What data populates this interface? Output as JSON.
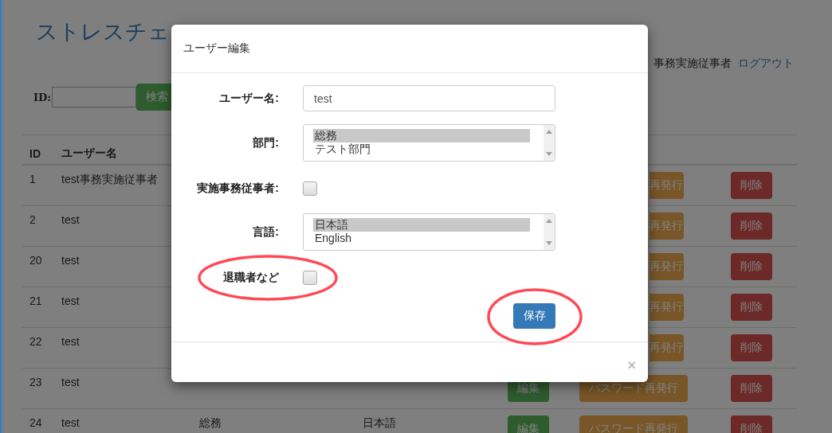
{
  "page": {
    "title": "ストレスチェ",
    "user": "事務実施従事者",
    "logout": "ログアウト",
    "search": {
      "label": "ID:",
      "button": "検索"
    },
    "table": {
      "columns": [
        "ID",
        "ユーザー名"
      ],
      "rows": [
        {
          "id": "1",
          "name": "test事務実施従事者",
          "reissue": "再発行",
          "delete": "削除"
        },
        {
          "id": "2",
          "name": "test",
          "reissue": "再発行",
          "delete": "削除"
        },
        {
          "id": "20",
          "name": "test",
          "reissue": "再発行",
          "delete": "削除"
        },
        {
          "id": "21",
          "name": "test",
          "reissue": "再発行",
          "delete": "削除"
        },
        {
          "id": "22",
          "name": "test",
          "reissue": "再発行",
          "delete": "削除"
        },
        {
          "id": "23",
          "name": "test",
          "edit": "編集",
          "reissue": "パスワード再発行",
          "delete": "削除"
        },
        {
          "id": "24",
          "name": "test",
          "department": "総務",
          "language": "日本語",
          "edit": "編集",
          "reissue": "パスワード再発行",
          "delete": "削除"
        }
      ]
    }
  },
  "dialog": {
    "title": "ユーザー編集",
    "fields": [
      {
        "kind": "text",
        "label": "ユーザー名:",
        "value": "test"
      },
      {
        "kind": "listbox",
        "label": "部門:",
        "options": [
          {
            "label": "総務",
            "selected": true
          },
          {
            "label": "テスト部門",
            "selected": false
          }
        ]
      },
      {
        "kind": "checkbox",
        "label": "実施事務従事者:",
        "checked": false
      },
      {
        "kind": "listbox",
        "label": "言語:",
        "options": [
          {
            "label": "日本語",
            "selected": true
          },
          {
            "label": "English",
            "selected": false
          }
        ]
      },
      {
        "kind": "checkbox",
        "label": "退職者など",
        "checked": false,
        "circled": true
      }
    ],
    "save": {
      "label": "保存",
      "circled": true
    },
    "close": "×"
  }
}
